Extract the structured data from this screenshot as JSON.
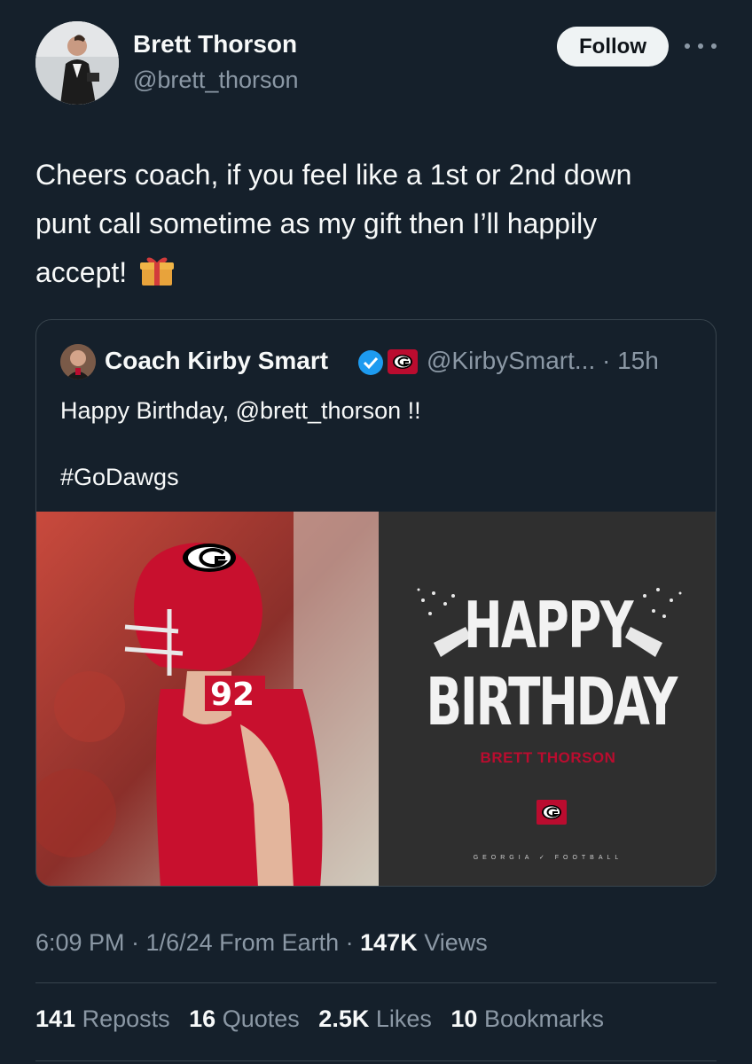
{
  "author": {
    "name": "Brett Thorson",
    "handle": "@brett_thorson",
    "follow_label": "Follow"
  },
  "tweet": {
    "line1": "Cheers coach, if you feel like a 1st or 2nd down",
    "line2": "punt call sometime as my gift then I’ll happily",
    "line3": "accept!"
  },
  "quote": {
    "name": "Coach Kirby Smart",
    "handle_time": "@KirbySmart... · 15h",
    "text": "Happy Birthday, @brett_thorson !!",
    "hashtag": "#GoDawgs",
    "image": {
      "jersey_number": "92",
      "line1": "HAPPY",
      "line2": "BIRTHDAY",
      "player_name": "BRETT THORSON",
      "footer": "GEORGIA ✓ FOOTBALL"
    }
  },
  "meta": {
    "time_date": "6:09 PM · 1/6/24 From Earth · ",
    "views_count": "147K",
    "views_label": " Views"
  },
  "stats": [
    {
      "count": "141",
      "label": "Reposts"
    },
    {
      "count": "16",
      "label": "Quotes"
    },
    {
      "count": "2.5K",
      "label": "Likes"
    },
    {
      "count": "10",
      "label": "Bookmarks"
    }
  ],
  "icons": [
    "more-icon",
    "gift-icon",
    "verified-icon",
    "georgia-g-badge"
  ],
  "colors": {
    "background": "#15202b",
    "verified": "#1d9bf0",
    "georgia_red": "#ba0c2f",
    "secondary_text": "#8b98a5"
  }
}
